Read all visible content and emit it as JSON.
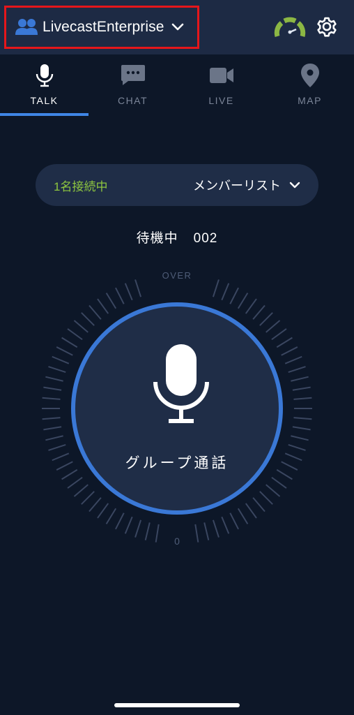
{
  "header": {
    "workspace_name": "LivecastEnterprise",
    "icons": {
      "workspace": "users-icon",
      "chevron": "chevron-down-icon",
      "status": "speedometer-icon",
      "settings": "gear-icon"
    }
  },
  "tabs": [
    {
      "label": "TALK",
      "icon": "microphone-icon",
      "active": true
    },
    {
      "label": "CHAT",
      "icon": "chat-bubble-icon",
      "active": false
    },
    {
      "label": "LIVE",
      "icon": "video-camera-icon",
      "active": false
    },
    {
      "label": "MAP",
      "icon": "map-pin-icon",
      "active": false
    }
  ],
  "members": {
    "connected_text": "1名接続中",
    "list_label": "メンバーリスト"
  },
  "status": {
    "label": "待機中",
    "channel": "002"
  },
  "meter": {
    "over_label": "OVER",
    "zero_label": "0"
  },
  "talk_button": {
    "label": "グループ通話"
  },
  "colors": {
    "background": "#0d1728",
    "header_bg": "#1d2a44",
    "accent_blue": "#3a78d6",
    "connected_green": "#8ec63f",
    "highlight_red": "#e5161b",
    "inactive_gray": "#7b8598"
  }
}
